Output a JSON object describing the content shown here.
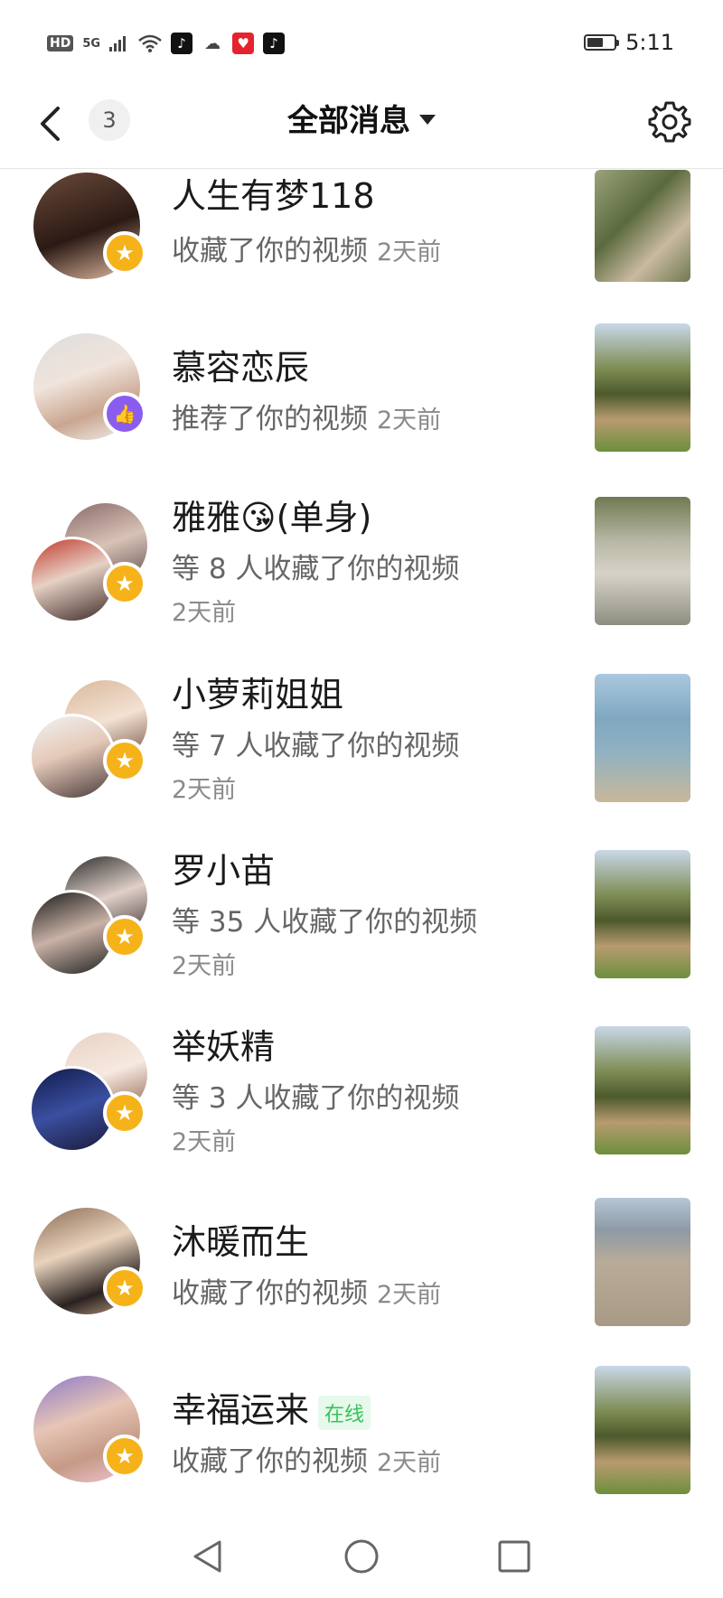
{
  "status_bar": {
    "hd": "HD",
    "network": "5G",
    "time": "5:11",
    "battery_level": 0.6
  },
  "header": {
    "unread_count": "3",
    "title": "全部消息"
  },
  "messages": [
    {
      "name": "人生有梦118",
      "action": "收藏了你的视频",
      "time": "2天前",
      "badge": "star"
    },
    {
      "name": "慕容恋辰",
      "action": "推荐了你的视频",
      "time": "2天前",
      "badge": "like"
    },
    {
      "name": "雅雅😘(单身)",
      "action": "等 8 人收藏了你的视频",
      "time": "2天前",
      "badge": "star"
    },
    {
      "name": "小萝莉姐姐",
      "action": "等 7 人收藏了你的视频",
      "time": "2天前",
      "badge": "star"
    },
    {
      "name": "罗小苗",
      "action": "等 35 人收藏了你的视频",
      "time": "2天前",
      "badge": "star"
    },
    {
      "name": "举妖精",
      "action": "等 3 人收藏了你的视频",
      "time": "2天前",
      "badge": "star"
    },
    {
      "name": "沐暖而生",
      "action": "收藏了你的视频",
      "time": "2天前",
      "badge": "star"
    },
    {
      "name": "幸福运来",
      "online_label": "在线",
      "action": "收藏了你的视频",
      "time": "2天前",
      "badge": "star"
    }
  ],
  "colors": {
    "star_badge": "#f6b219",
    "like_badge": "#8a5df0",
    "online": "#37c25b"
  }
}
